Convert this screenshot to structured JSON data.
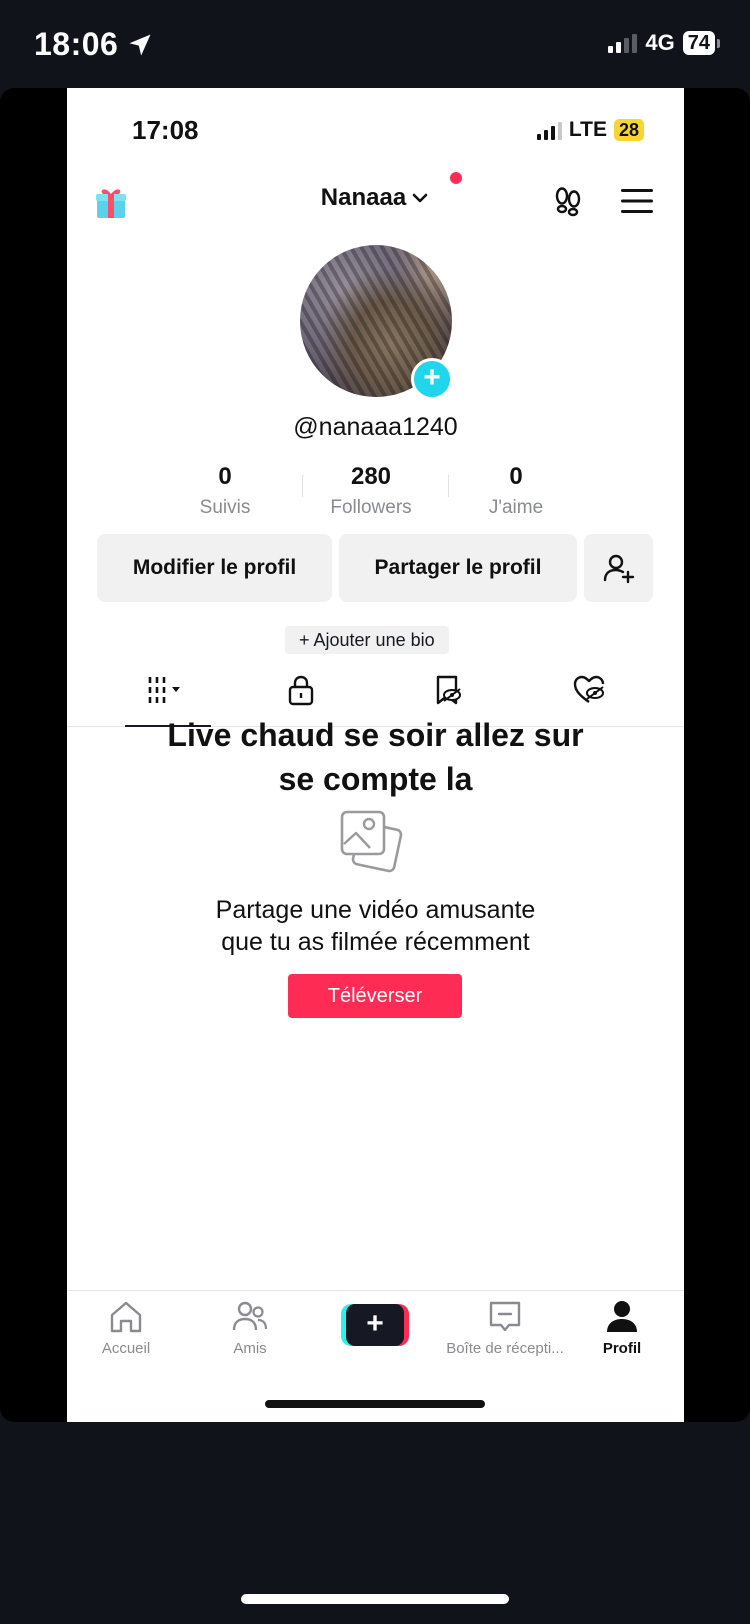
{
  "outer_status": {
    "time": "18:06",
    "network": "4G",
    "battery": "74"
  },
  "inner_status": {
    "time": "17:08",
    "network": "LTE",
    "battery": "28"
  },
  "header": {
    "username": "Nanaaa"
  },
  "profile": {
    "handle": "@nanaaa1240",
    "stats": [
      {
        "value": "0",
        "label": "Suivis"
      },
      {
        "value": "280",
        "label": "Followers"
      },
      {
        "value": "0",
        "label": "J'aime"
      }
    ],
    "edit_label": "Modifier le profil",
    "share_label": "Partager le profil",
    "bio_label": "+ Ajouter une bio"
  },
  "caption": {
    "line1": "Live chaud se soir allez sur",
    "line2": "se compte la"
  },
  "empty_state": {
    "line1": "Partage une vidéo amusante",
    "line2": "que tu as filmée récemment",
    "button": "Téléverser"
  },
  "bottom_nav": {
    "home": "Accueil",
    "friends": "Amis",
    "inbox": "Boîte de récepti...",
    "profile": "Profil"
  },
  "colors": {
    "accent": "#fe2c55",
    "cyan": "#20d5ec",
    "battery_inner": "#f7d634"
  }
}
